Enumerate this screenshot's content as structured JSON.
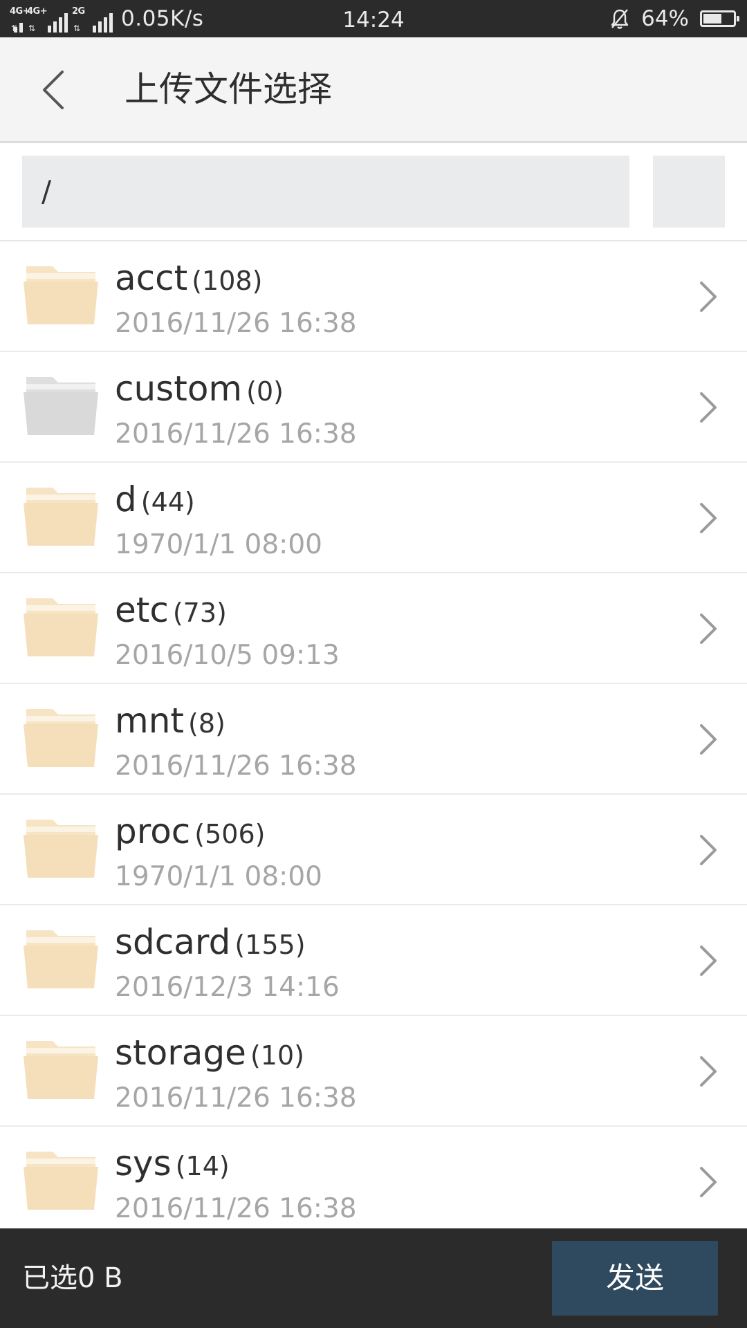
{
  "status_bar": {
    "network_1": "4G+",
    "network_2": "4G+",
    "network_3": "2G",
    "speed": "0.05K/s",
    "time": "14:24",
    "battery": "64%",
    "battery_level": 0.64
  },
  "header": {
    "title": "上传文件选择"
  },
  "path": {
    "value": "/"
  },
  "files": [
    {
      "name": "acct",
      "count": "(108)",
      "date": "2016/11/26 16:38",
      "folder_color": "#f4dfba"
    },
    {
      "name": "custom",
      "count": "(0)",
      "date": "2016/11/26 16:38",
      "folder_color": "#d9d9d9"
    },
    {
      "name": "d",
      "count": "(44)",
      "date": "1970/1/1 08:00",
      "folder_color": "#f4dfba"
    },
    {
      "name": "etc",
      "count": "(73)",
      "date": "2016/10/5 09:13",
      "folder_color": "#f4dfba"
    },
    {
      "name": "mnt",
      "count": "(8)",
      "date": "2016/11/26 16:38",
      "folder_color": "#f4dfba"
    },
    {
      "name": "proc",
      "count": "(506)",
      "date": "1970/1/1 08:00",
      "folder_color": "#f4dfba"
    },
    {
      "name": "sdcard",
      "count": "(155)",
      "date": "2016/12/3 14:16",
      "folder_color": "#f4dfba"
    },
    {
      "name": "storage",
      "count": "(10)",
      "date": "2016/11/26 16:38",
      "folder_color": "#f4dfba"
    },
    {
      "name": "sys",
      "count": "(14)",
      "date": "2016/11/26 16:38",
      "folder_color": "#f4dfba"
    }
  ],
  "footer": {
    "selected_label": "已选0 B",
    "send_label": "发送"
  }
}
